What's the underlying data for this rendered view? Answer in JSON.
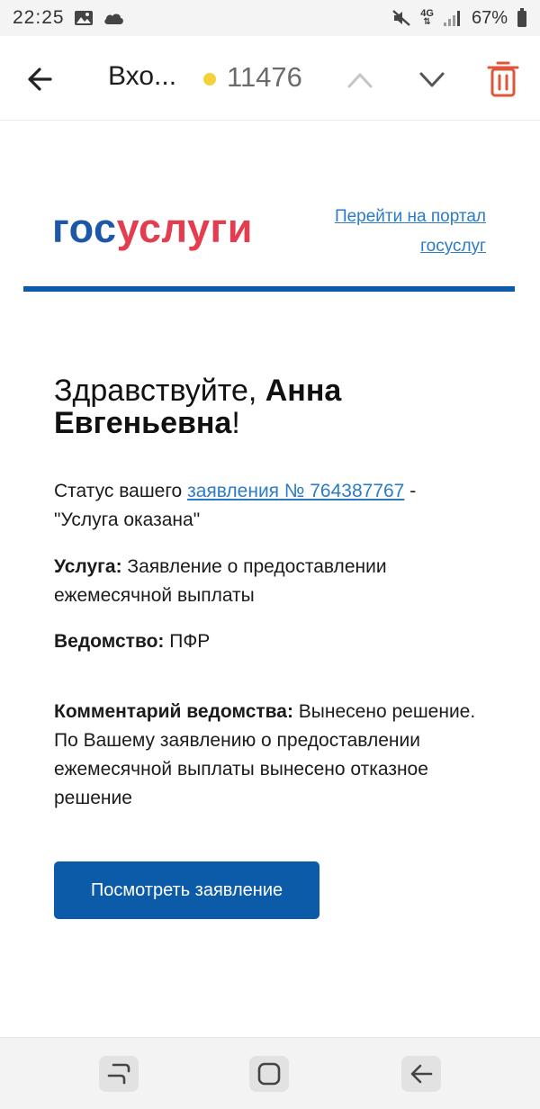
{
  "status_bar": {
    "time": "22:25",
    "network": "4G",
    "battery": "67%",
    "icons": [
      "image-icon",
      "cloud-icon",
      "mute-icon",
      "signal-icon",
      "battery-icon"
    ]
  },
  "toolbar": {
    "folder_title": "Вхо...",
    "unread_count": "11476",
    "unread_dot_color": "#f6d23a",
    "trash_color": "#e0553a"
  },
  "email": {
    "logo": {
      "part1": "гос",
      "part2": "услуги",
      "color1": "#1d58a8",
      "color2": "#e33e4f"
    },
    "portal_link": "Перейти на портал госуслуг",
    "greeting": {
      "hello": "Здравствуйте, ",
      "name": "Анна Евгеньевна",
      "end": "!"
    },
    "status": {
      "prefix": "Статус вашего ",
      "link": "заявления № 764387767",
      "suffix": " - \"Услуга оказана\""
    },
    "service": {
      "label": "Услуга:",
      "value": " Заявление о предоставлении ежемесячной выплаты"
    },
    "department": {
      "label": "Ведомство:",
      "value": " ПФР"
    },
    "comment": {
      "label": "Комментарий ведомства:",
      "value": " Вынесено решение. По Вашему заявлению о предоставлении ежемесячной выплаты вынесено отказное решение"
    },
    "button_label": "Посмотреть заявление",
    "accent_color": "#0b5ba9"
  },
  "nav_bar": {
    "buttons": [
      "recent-apps",
      "home",
      "back"
    ]
  }
}
